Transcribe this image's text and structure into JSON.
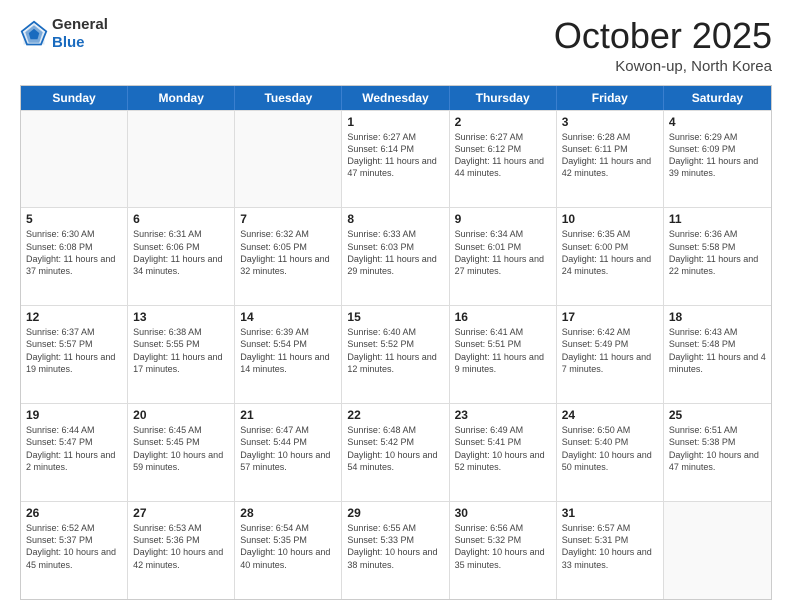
{
  "header": {
    "logo_general": "General",
    "logo_blue": "Blue",
    "month": "October 2025",
    "location": "Kowon-up, North Korea"
  },
  "days_of_week": [
    "Sunday",
    "Monday",
    "Tuesday",
    "Wednesday",
    "Thursday",
    "Friday",
    "Saturday"
  ],
  "weeks": [
    [
      {
        "day": "",
        "info": ""
      },
      {
        "day": "",
        "info": ""
      },
      {
        "day": "",
        "info": ""
      },
      {
        "day": "1",
        "info": "Sunrise: 6:27 AM\nSunset: 6:14 PM\nDaylight: 11 hours and 47 minutes."
      },
      {
        "day": "2",
        "info": "Sunrise: 6:27 AM\nSunset: 6:12 PM\nDaylight: 11 hours and 44 minutes."
      },
      {
        "day": "3",
        "info": "Sunrise: 6:28 AM\nSunset: 6:11 PM\nDaylight: 11 hours and 42 minutes."
      },
      {
        "day": "4",
        "info": "Sunrise: 6:29 AM\nSunset: 6:09 PM\nDaylight: 11 hours and 39 minutes."
      }
    ],
    [
      {
        "day": "5",
        "info": "Sunrise: 6:30 AM\nSunset: 6:08 PM\nDaylight: 11 hours and 37 minutes."
      },
      {
        "day": "6",
        "info": "Sunrise: 6:31 AM\nSunset: 6:06 PM\nDaylight: 11 hours and 34 minutes."
      },
      {
        "day": "7",
        "info": "Sunrise: 6:32 AM\nSunset: 6:05 PM\nDaylight: 11 hours and 32 minutes."
      },
      {
        "day": "8",
        "info": "Sunrise: 6:33 AM\nSunset: 6:03 PM\nDaylight: 11 hours and 29 minutes."
      },
      {
        "day": "9",
        "info": "Sunrise: 6:34 AM\nSunset: 6:01 PM\nDaylight: 11 hours and 27 minutes."
      },
      {
        "day": "10",
        "info": "Sunrise: 6:35 AM\nSunset: 6:00 PM\nDaylight: 11 hours and 24 minutes."
      },
      {
        "day": "11",
        "info": "Sunrise: 6:36 AM\nSunset: 5:58 PM\nDaylight: 11 hours and 22 minutes."
      }
    ],
    [
      {
        "day": "12",
        "info": "Sunrise: 6:37 AM\nSunset: 5:57 PM\nDaylight: 11 hours and 19 minutes."
      },
      {
        "day": "13",
        "info": "Sunrise: 6:38 AM\nSunset: 5:55 PM\nDaylight: 11 hours and 17 minutes."
      },
      {
        "day": "14",
        "info": "Sunrise: 6:39 AM\nSunset: 5:54 PM\nDaylight: 11 hours and 14 minutes."
      },
      {
        "day": "15",
        "info": "Sunrise: 6:40 AM\nSunset: 5:52 PM\nDaylight: 11 hours and 12 minutes."
      },
      {
        "day": "16",
        "info": "Sunrise: 6:41 AM\nSunset: 5:51 PM\nDaylight: 11 hours and 9 minutes."
      },
      {
        "day": "17",
        "info": "Sunrise: 6:42 AM\nSunset: 5:49 PM\nDaylight: 11 hours and 7 minutes."
      },
      {
        "day": "18",
        "info": "Sunrise: 6:43 AM\nSunset: 5:48 PM\nDaylight: 11 hours and 4 minutes."
      }
    ],
    [
      {
        "day": "19",
        "info": "Sunrise: 6:44 AM\nSunset: 5:47 PM\nDaylight: 11 hours and 2 minutes."
      },
      {
        "day": "20",
        "info": "Sunrise: 6:45 AM\nSunset: 5:45 PM\nDaylight: 10 hours and 59 minutes."
      },
      {
        "day": "21",
        "info": "Sunrise: 6:47 AM\nSunset: 5:44 PM\nDaylight: 10 hours and 57 minutes."
      },
      {
        "day": "22",
        "info": "Sunrise: 6:48 AM\nSunset: 5:42 PM\nDaylight: 10 hours and 54 minutes."
      },
      {
        "day": "23",
        "info": "Sunrise: 6:49 AM\nSunset: 5:41 PM\nDaylight: 10 hours and 52 minutes."
      },
      {
        "day": "24",
        "info": "Sunrise: 6:50 AM\nSunset: 5:40 PM\nDaylight: 10 hours and 50 minutes."
      },
      {
        "day": "25",
        "info": "Sunrise: 6:51 AM\nSunset: 5:38 PM\nDaylight: 10 hours and 47 minutes."
      }
    ],
    [
      {
        "day": "26",
        "info": "Sunrise: 6:52 AM\nSunset: 5:37 PM\nDaylight: 10 hours and 45 minutes."
      },
      {
        "day": "27",
        "info": "Sunrise: 6:53 AM\nSunset: 5:36 PM\nDaylight: 10 hours and 42 minutes."
      },
      {
        "day": "28",
        "info": "Sunrise: 6:54 AM\nSunset: 5:35 PM\nDaylight: 10 hours and 40 minutes."
      },
      {
        "day": "29",
        "info": "Sunrise: 6:55 AM\nSunset: 5:33 PM\nDaylight: 10 hours and 38 minutes."
      },
      {
        "day": "30",
        "info": "Sunrise: 6:56 AM\nSunset: 5:32 PM\nDaylight: 10 hours and 35 minutes."
      },
      {
        "day": "31",
        "info": "Sunrise: 6:57 AM\nSunset: 5:31 PM\nDaylight: 10 hours and 33 minutes."
      },
      {
        "day": "",
        "info": ""
      }
    ]
  ]
}
